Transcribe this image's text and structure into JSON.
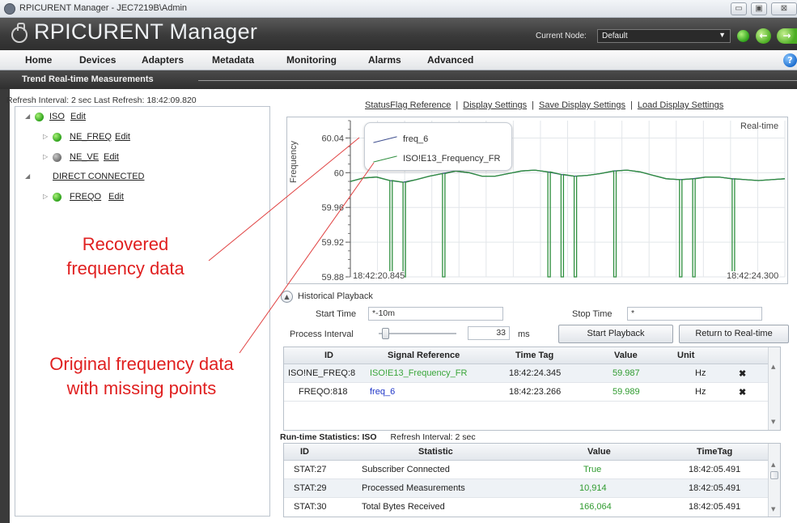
{
  "window": {
    "title": "RPICURENT Manager - JEC7219B\\Admin",
    "buttons": [
      "▭",
      "▣",
      "⊠"
    ]
  },
  "header": {
    "app_title": "RPICURENT Manager",
    "current_node_label": "Current Node:",
    "current_node_value": "Default",
    "status_color": "#2ea31a"
  },
  "menu": {
    "items": [
      "Home",
      "Devices",
      "Adapters",
      "Metadata",
      "Monitoring",
      "Alarms",
      "Advanced"
    ],
    "help": "?"
  },
  "section_title": "Trend Real-time Measurements",
  "refresh_info": "Refresh Interval: 2 sec Last Refresh: 18:42:09.820",
  "tree": {
    "iso": {
      "label": "ISO",
      "edit": "Edit"
    },
    "ne_freq": {
      "label": "NE_FREQ",
      "edit": "Edit"
    },
    "ne_ve": {
      "label": "NE_VE",
      "edit": "Edit"
    },
    "direct": {
      "label": "DIRECT CONNECTED"
    },
    "freqo": {
      "label": "FREQO",
      "edit": "Edit"
    }
  },
  "annotations": {
    "recovered_line1": "Recovered",
    "recovered_line2": "frequency data",
    "original_line1": "Original frequency data",
    "original_line2": "with missing points"
  },
  "links": {
    "statusflag": "StatusFlag Reference",
    "display": "Display Settings",
    "save": "Save Display Settings",
    "load": "Load Display Settings",
    "sep": "|"
  },
  "chart_data": {
    "type": "line",
    "ylabel": "Frequency",
    "ylim": [
      59.88,
      60.06
    ],
    "yticks": [
      "60.04",
      "60",
      "59.96",
      "59.92",
      "59.88"
    ],
    "x_start_label": "18:42:20.845",
    "x_end_label": "18:42:24.300",
    "mode_label": "Real-time",
    "grid": true,
    "legend_placement": "top-left",
    "series": [
      {
        "name": "freq_6",
        "color": "#3f4f8f",
        "values": [
          59.99,
          59.994,
          59.995,
          59.991,
          59.989,
          59.992,
          59.996,
          59.999,
          60.002,
          60.0,
          59.996,
          59.996,
          59.999,
          60.002,
          60.003,
          60.001,
          59.998,
          59.996,
          59.997,
          59.999,
          60.002,
          60.003,
          60.001,
          59.997,
          59.993,
          59.992,
          59.993,
          59.995,
          59.995,
          59.993,
          59.992,
          59.991,
          59.992,
          59.993
        ]
      },
      {
        "name": "ISO!E13_Frequency_FR",
        "color": "#2f8f3f",
        "values": [
          59.99,
          59.994,
          59.995,
          59.991,
          59.989,
          59.992,
          59.996,
          59.999,
          60.002,
          60.0,
          59.996,
          59.996,
          59.999,
          60.002,
          60.003,
          60.001,
          59.998,
          59.996,
          59.997,
          59.999,
          60.002,
          60.003,
          60.001,
          59.997,
          59.993,
          59.992,
          59.993,
          59.995,
          59.995,
          59.993,
          59.992,
          59.991,
          59.992,
          59.993
        ],
        "dropout_indices": [
          3,
          4,
          7,
          15,
          16,
          17,
          20,
          25,
          26,
          29
        ]
      }
    ]
  },
  "playback": {
    "title": "Historical Playback",
    "start_label": "Start Time",
    "start_value": "*-10m",
    "stop_label": "Stop Time",
    "stop_value": "*",
    "interval_label": "Process Interval",
    "interval_value": "33",
    "interval_unit": "ms",
    "start_button": "Start Playback",
    "return_button": "Return to Real-time"
  },
  "measurements": {
    "headers": [
      "ID",
      "Signal Reference",
      "Time Tag",
      "Value",
      "Unit"
    ],
    "rows": [
      {
        "id": "ISO!NE_FREQ:8",
        "signal": "ISO!E13_Frequency_FR",
        "time": "18:42:24.345",
        "value": "59.987",
        "unit": "Hz"
      },
      {
        "id": "FREQO:818",
        "signal": "freq_6",
        "time": "18:42:23.266",
        "value": "59.989",
        "unit": "Hz"
      }
    ],
    "remove_icon": "✖"
  },
  "runtime": {
    "title": "Run-time Statistics: ISO",
    "refresh": "Refresh Interval: 2 sec",
    "headers": [
      "ID",
      "Statistic",
      "Value",
      "TimeTag"
    ],
    "rows": [
      {
        "id": "STAT:27",
        "stat": "Subscriber Connected",
        "value": "True",
        "time": "18:42:05.491"
      },
      {
        "id": "STAT:29",
        "stat": "Processed Measurements",
        "value": "10,914",
        "time": "18:42:05.491"
      },
      {
        "id": "STAT:30",
        "stat": "Total Bytes Received",
        "value": "166,064",
        "time": "18:42:05.491"
      }
    ]
  }
}
